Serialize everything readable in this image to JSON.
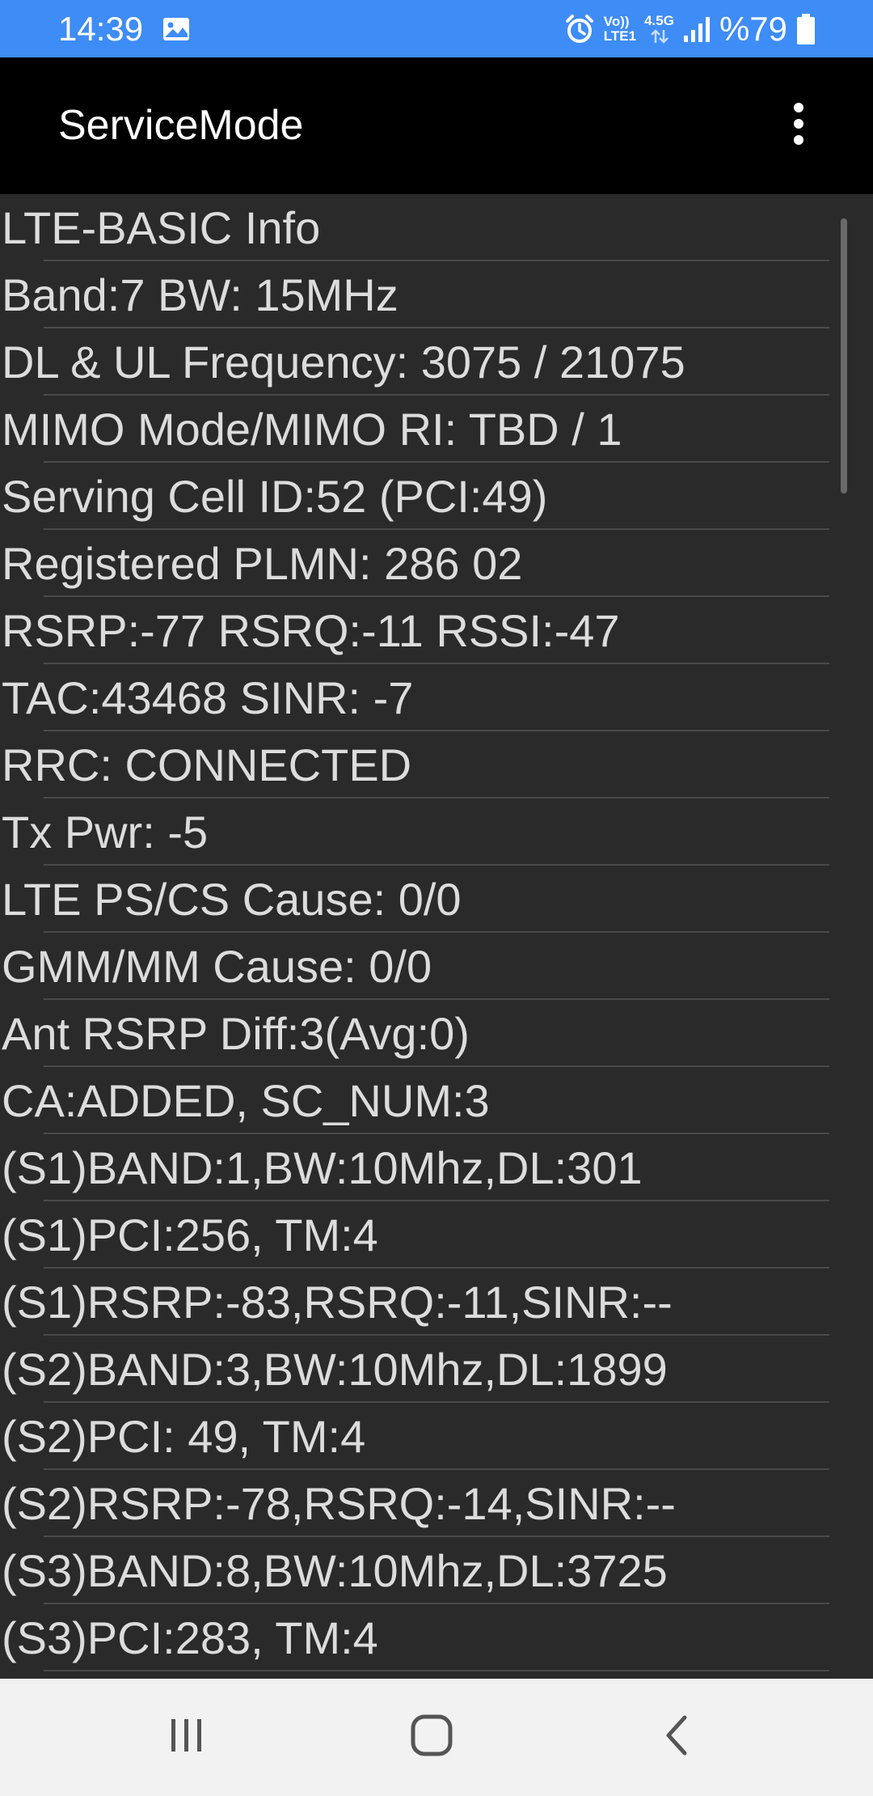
{
  "status_bar": {
    "time": "14:39",
    "network_top": "Vo))",
    "network_bottom": "LTE1",
    "network_type": "4.5G",
    "battery": "%79",
    "icons": [
      "gallery-icon",
      "alarm-icon",
      "data-arrows-icon",
      "signal-icon",
      "battery-icon"
    ]
  },
  "app_bar": {
    "title": "ServiceMode",
    "overflow_icon": "more-vert-icon"
  },
  "info_list": {
    "items": [
      "LTE-BASIC Info",
      "Band:7 BW: 15MHz",
      "DL & UL Frequency: 3075 / 21075",
      "MIMO Mode/MIMO RI: TBD / 1",
      "Serving Cell ID:52 (PCI:49)",
      "Registered PLMN: 286 02",
      "RSRP:-77 RSRQ:-11 RSSI:-47",
      "TAC:43468 SINR: -7",
      "RRC: CONNECTED",
      "Tx Pwr: -5",
      "LTE PS/CS Cause: 0/0",
      "GMM/MM Cause: 0/0",
      "Ant RSRP Diff:3(Avg:0)",
      "CA:ADDED, SC_NUM:3",
      "(S1)BAND:1,BW:10Mhz,DL:301",
      "(S1)PCI:256, TM:4",
      "(S1)RSRP:-83,RSRQ:-11,SINR:--",
      "(S2)BAND:3,BW:10Mhz,DL:1899",
      "(S2)PCI: 49, TM:4",
      "(S2)RSRP:-78,RSRQ:-14,SINR:--",
      "(S3)BAND:8,BW:10Mhz,DL:3725",
      "(S3)PCI:283, TM:4"
    ]
  },
  "nav_bar": {
    "buttons": [
      "recent-apps-icon",
      "home-icon",
      "back-icon"
    ]
  },
  "colors": {
    "status_bar": "#3e8cf5",
    "app_bar": "#000000",
    "content_bg": "#2a2a2a",
    "text": "#dcdcdc",
    "divider": "#4a4a4a",
    "nav_bar": "#f2f2f2"
  }
}
